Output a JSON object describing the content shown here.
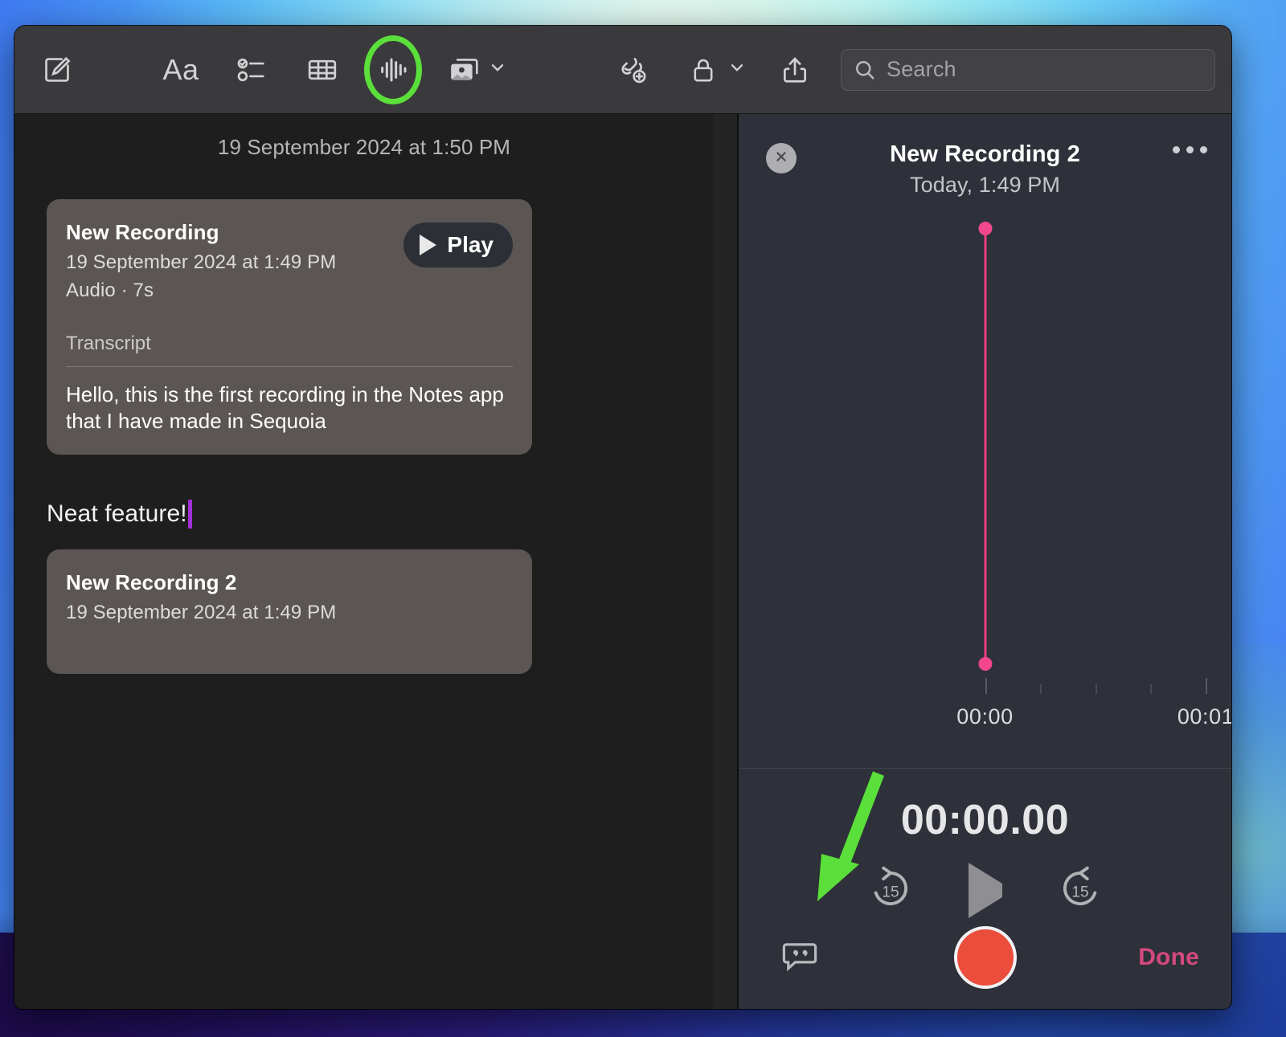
{
  "toolbar": {
    "new_note_icon": "compose-icon",
    "format_label": "Aa",
    "checklist_icon": "checklist-icon",
    "table_icon": "table-icon",
    "audio_icon": "audio-waveform-icon",
    "media_icon": "media-icon",
    "media_chevron_icon": "chevron-down-icon",
    "collaborate_icon": "add-collaborator-icon",
    "lock_icon": "lock-icon",
    "lock_chevron_icon": "chevron-down-icon",
    "share_icon": "share-icon",
    "highlight_color": "#5bdf3a"
  },
  "search": {
    "placeholder": "Search",
    "value": "",
    "icon": "search-icon"
  },
  "note": {
    "date_header": "19 September 2024 at 1:50 PM",
    "body_text": "Neat feature!",
    "caret_color": "#a32fd6",
    "recordings": [
      {
        "title": "New Recording",
        "timestamp": "19 September 2024 at 1:49 PM",
        "meta": "Audio · 7s",
        "play_label": "Play",
        "play_icon": "play-icon",
        "transcript_label": "Transcript",
        "transcript_text": "Hello, this is the first recording in the Notes app that I have made in Sequoia"
      },
      {
        "title": "New Recording 2",
        "timestamp": "19 September 2024 at 1:49 PM"
      }
    ]
  },
  "panel": {
    "close_icon": "close-icon",
    "title": "New Recording 2",
    "subtitle": "Today, 1:49 PM",
    "more_icon": "ellipsis-icon",
    "playhead_color": "#f2478b",
    "timeline": {
      "labels": [
        "00:00",
        "00:01"
      ],
      "ticks": 9
    },
    "timer": "00:00.00",
    "transport": {
      "skip_back_label": "15",
      "skip_back_icon": "skip-back-15-icon",
      "play_icon": "play-icon",
      "skip_forward_label": "15",
      "skip_forward_icon": "skip-forward-15-icon"
    },
    "transcript_toggle_icon": "transcript-quote-icon",
    "record_icon": "record-button",
    "record_color": "#eb4d3d",
    "done_label": "Done",
    "done_color": "#d44a7e"
  },
  "annotations": {
    "arrow_color": "#5bdf3a",
    "circle_target": "audio-waveform-icon",
    "arrow_target": "transcript-quote-icon"
  }
}
